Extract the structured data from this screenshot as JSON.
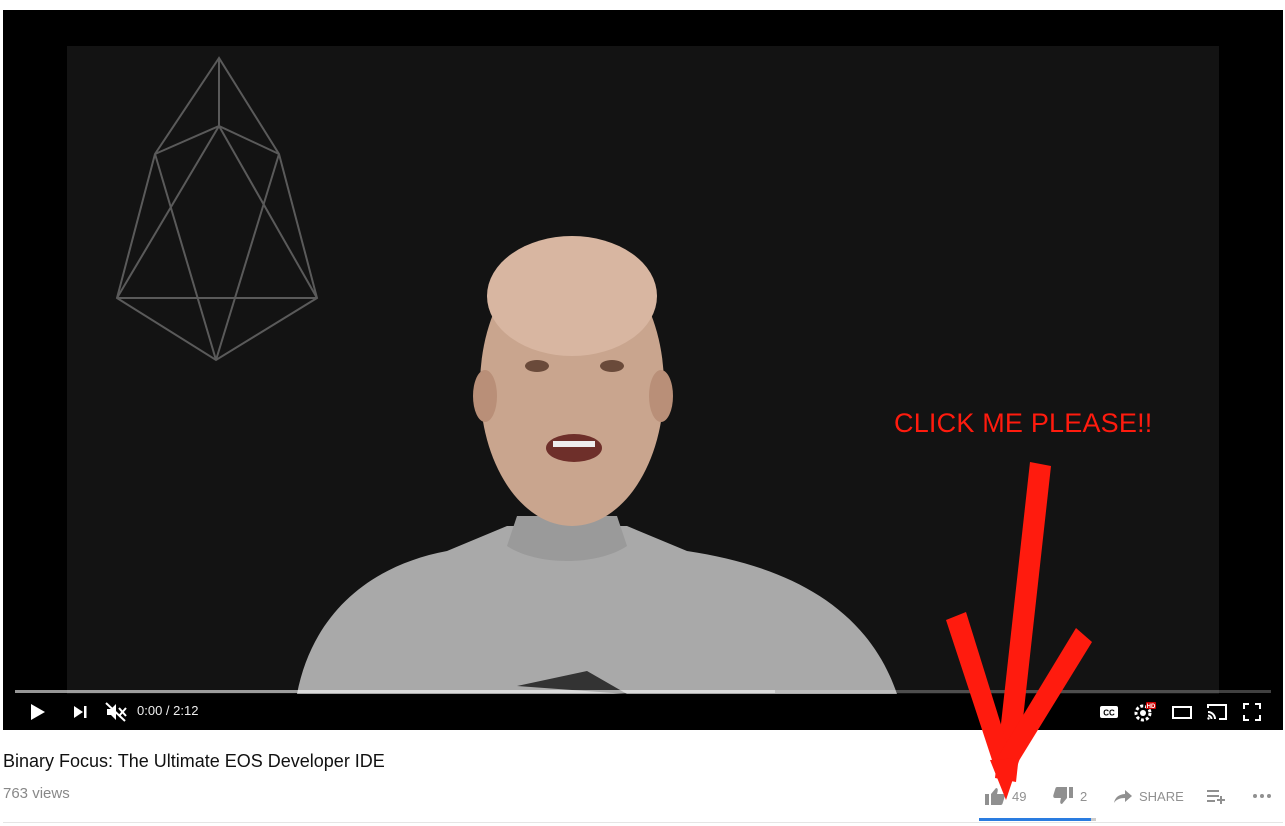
{
  "video": {
    "overlay_text": "CLICK ME PLEASE!!",
    "progress_loaded_fraction": 0.605
  },
  "player": {
    "time_display": "0:00 / 2:12",
    "icons": {
      "play": "play-icon",
      "next": "next-icon",
      "volume": "volume-muted-icon",
      "captions": "cc-icon",
      "settings": "settings-hd-icon",
      "theater": "theater-mode-icon",
      "cast": "cast-icon",
      "fullscreen": "fullscreen-icon"
    }
  },
  "meta": {
    "title": "Binary Focus: The Ultimate EOS Developer IDE",
    "views": "763 views"
  },
  "actions": {
    "like_count": "49",
    "dislike_count": "2",
    "share_label": "SHARE",
    "like_fraction": 0.96
  },
  "colors": {
    "overlay_red": "#ff1b0e",
    "sentiment_blue": "#2a7ce0",
    "icon_grey": "#909090"
  }
}
